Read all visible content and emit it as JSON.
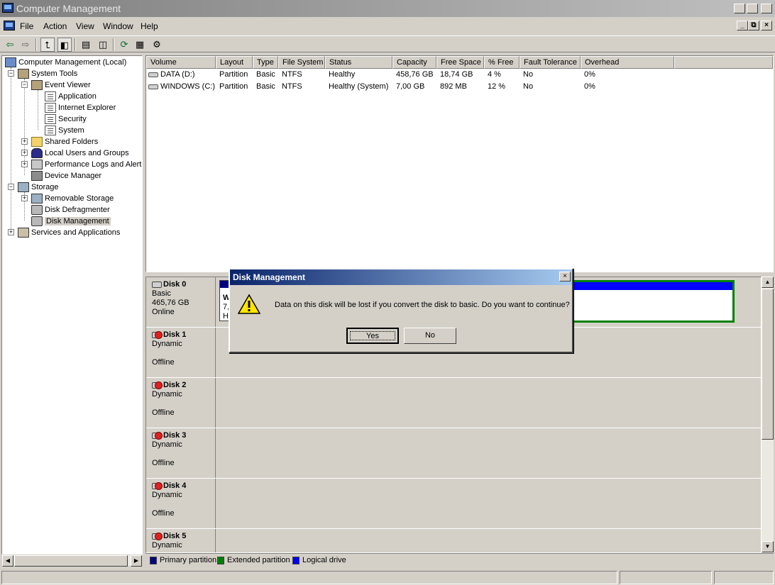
{
  "window": {
    "title": "Computer Management",
    "controls": {
      "minimize": "_",
      "maximize": "□",
      "close": "×"
    }
  },
  "menu": [
    {
      "label": "File"
    },
    {
      "label": "Action"
    },
    {
      "label": "View"
    },
    {
      "label": "Window"
    },
    {
      "label": "Help"
    }
  ],
  "tree": {
    "root": "Computer Management (Local)",
    "system_tools": "System Tools",
    "event_viewer": "Event Viewer",
    "application": "Application",
    "internet_explorer": "Internet Explorer",
    "security": "Security",
    "system": "System",
    "shared_folders": "Shared Folders",
    "local_users": "Local Users and Groups",
    "perf_logs": "Performance Logs and Alerts",
    "device_manager": "Device Manager",
    "storage": "Storage",
    "removable_storage": "Removable Storage",
    "disk_defragmenter": "Disk Defragmenter",
    "disk_management": "Disk Management",
    "services": "Services and Applications"
  },
  "volumes": {
    "columns": [
      "Volume",
      "Layout",
      "Type",
      "File System",
      "Status",
      "Capacity",
      "Free Space",
      "% Free",
      "Fault Tolerance",
      "Overhead"
    ],
    "rows": [
      [
        "DATA (D:)",
        "Partition",
        "Basic",
        "NTFS",
        "Healthy",
        "458,76 GB",
        "18,74 GB",
        "4 %",
        "No",
        "0%"
      ],
      [
        "WINDOWS (C:)",
        "Partition",
        "Basic",
        "NTFS",
        "Healthy (System)",
        "7,00 GB",
        "892 MB",
        "12 %",
        "No",
        "0%"
      ]
    ]
  },
  "disks": [
    {
      "name": "Disk 0",
      "type": "Basic",
      "size": "465,76 GB",
      "state": "Online"
    },
    {
      "name": "Disk 1",
      "type": "Dynamic",
      "size": "",
      "state": "Offline"
    },
    {
      "name": "Disk 2",
      "type": "Dynamic",
      "size": "",
      "state": "Offline"
    },
    {
      "name": "Disk 3",
      "type": "Dynamic",
      "size": "",
      "state": "Offline"
    },
    {
      "name": "Disk 4",
      "type": "Dynamic",
      "size": "",
      "state": "Offline"
    },
    {
      "name": "Disk 5",
      "type": "Dynamic",
      "size": "",
      "state": ""
    }
  ],
  "disk0_partition_fragments": {
    "line1": "W",
    "line2": "7,",
    "line3": "H"
  },
  "legend": [
    {
      "label": "Primary partition",
      "color": "#00007f"
    },
    {
      "label": "Extended partition",
      "color": "#008000"
    },
    {
      "label": "Logical drive",
      "color": "#0000ff"
    }
  ],
  "dialog": {
    "title": "Disk Management",
    "message": "Data on this disk will be lost if you convert the disk to basic. Do you want to continue?",
    "yes": "Yes",
    "no": "No",
    "icon": "warning-icon"
  },
  "colors": {
    "dialog_title_start": "#0a246a",
    "dialog_title_end": "#a6caf0",
    "primary_partition": "#00007f",
    "logical_drive": "#0000ff",
    "extended_partition": "#008000"
  }
}
